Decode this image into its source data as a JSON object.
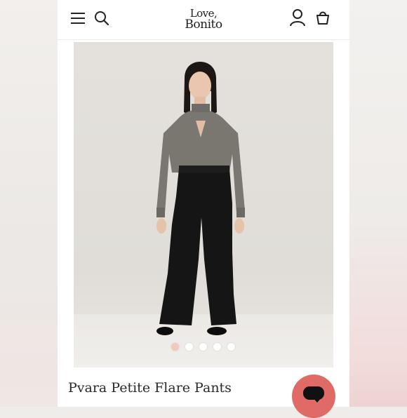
{
  "header": {
    "logo_line1": "Love,",
    "logo_line2": "Bonito",
    "icons": [
      "menu-icon",
      "search-icon",
      "account-icon",
      "shopping-bag-icon"
    ]
  },
  "gallery": {
    "image_count": 5,
    "active_index": 0
  },
  "product": {
    "title": "Pvara Petite Flare Pants"
  },
  "chat": {
    "icon": "chat-bubble-icon"
  },
  "colors": {
    "accent": "#e06b66",
    "active_dot": "#f2c9bd",
    "text": "#2a2a2a"
  }
}
